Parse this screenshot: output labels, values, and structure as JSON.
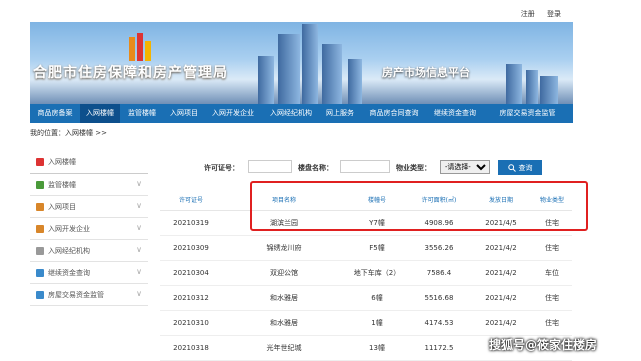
{
  "toplinks": {
    "register": "注册",
    "login": "登录"
  },
  "banner": {
    "title_left": "合肥市住房保障和房产管理局",
    "title_right": "房产市场信息平台"
  },
  "nav": {
    "items": [
      "商品房备案",
      "入网楼幢",
      "监管楼幢",
      "入网项目",
      "入网开发企业",
      "入网经纪机构",
      "网上服务",
      "商品房合同查询",
      "继续资金查询",
      "房屋交易资金监管"
    ]
  },
  "breadcrumb": "我的位置：入网楼幢 >>",
  "sidebar": {
    "items": [
      "入网楼幢",
      "监管楼幢",
      "入网项目",
      "入网开发企业",
      "入网经纪机构",
      "继续资金查询",
      "房屋交易资金监管"
    ]
  },
  "filter": {
    "license_label": "许可证号：",
    "building_label": "楼盘名称：",
    "type_label": "物业类型：",
    "type_selected": "-请选择-",
    "query_button": "查询"
  },
  "table": {
    "headers": [
      "许可证号",
      "项目名称",
      "楼幢号",
      "许可面积(㎡)",
      "发放日期",
      "物业类型"
    ],
    "rows": [
      [
        "20210319",
        "湖滨兰园",
        "Y7幢",
        "4908.96",
        "2021/4/5",
        "住宅"
      ],
      [
        "20210309",
        "锦绣龙川府",
        "F5幢",
        "3556.26",
        "2021/4/2",
        "住宅"
      ],
      [
        "20210304",
        "双迎公馆",
        "地下车库（2）",
        "7586.4",
        "2021/4/2",
        "车位"
      ],
      [
        "20210312",
        "和水雅居",
        "6幢",
        "5516.68",
        "2021/4/2",
        "住宅"
      ],
      [
        "20210310",
        "和水雅居",
        "1幢",
        "4174.53",
        "2021/4/2",
        "住宅"
      ],
      [
        "20210318",
        "光年世纪城",
        "13幢",
        "11172.5",
        "",
        ""
      ]
    ]
  },
  "watermark": "搜狐号@筱家住楼房",
  "colors": {
    "nav_blue": "#1a6fb4",
    "nav_active": "#0d4f8c",
    "highlight_red": "#e02020"
  }
}
